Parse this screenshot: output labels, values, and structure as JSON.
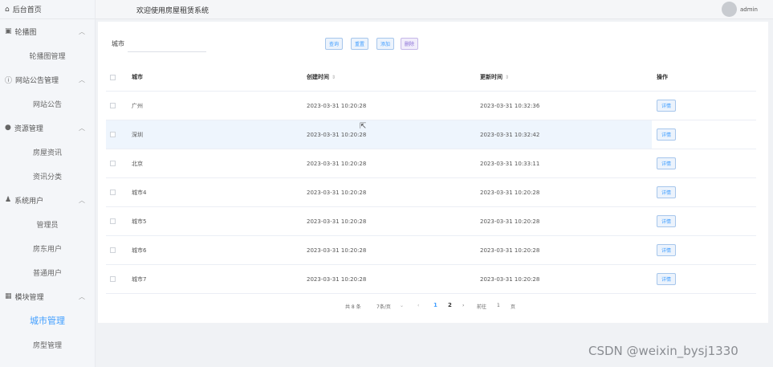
{
  "sidebar": {
    "home": "后台首页",
    "groups": [
      {
        "label": "轮播图",
        "items": [
          "轮播图管理"
        ]
      },
      {
        "label": "网站公告管理",
        "items": [
          "网站公告"
        ]
      },
      {
        "label": "资源管理",
        "items": [
          "房屋资讯",
          "资讯分类"
        ]
      },
      {
        "label": "系统用户",
        "items": [
          "管理员",
          "房东用户",
          "普通用户"
        ]
      },
      {
        "label": "模块管理",
        "items": [
          "城市管理",
          "房型管理"
        ]
      }
    ],
    "active": "城市管理"
  },
  "header": {
    "title": "欢迎使用房屋租赁系统",
    "user": "admin"
  },
  "filter": {
    "city_label": "城市",
    "city_value": "",
    "buttons": {
      "search": "查询",
      "reset": "重置",
      "add": "添加",
      "delete": "删除"
    }
  },
  "table": {
    "columns": {
      "city": "城市",
      "created": "创建时间",
      "updated": "更新时间",
      "op": "操作"
    },
    "sort_icon": "⇕",
    "detail_label": "详情",
    "rows": [
      {
        "city": "广州",
        "created": "2023-03-31 10:20:28",
        "updated": "2023-03-31 10:32:36"
      },
      {
        "city": "深圳",
        "created": "2023-03-31 10:20:28",
        "updated": "2023-03-31 10:32:42"
      },
      {
        "city": "北京",
        "created": "2023-03-31 10:20:28",
        "updated": "2023-03-31 10:33:11"
      },
      {
        "city": "城市4",
        "created": "2023-03-31 10:20:28",
        "updated": "2023-03-31 10:20:28"
      },
      {
        "city": "城市5",
        "created": "2023-03-31 10:20:28",
        "updated": "2023-03-31 10:20:28"
      },
      {
        "city": "城市6",
        "created": "2023-03-31 10:20:28",
        "updated": "2023-03-31 10:20:28"
      },
      {
        "city": "城市7",
        "created": "2023-03-31 10:20:28",
        "updated": "2023-03-31 10:20:28"
      }
    ]
  },
  "pagination": {
    "total": "共 8 条",
    "page_size": "7条/页",
    "pages": [
      "1",
      "2"
    ],
    "current": "1",
    "goto_label": "前往",
    "goto_value": "1",
    "goto_unit": "页"
  },
  "watermark": "CSDN @weixin_bysj1330"
}
